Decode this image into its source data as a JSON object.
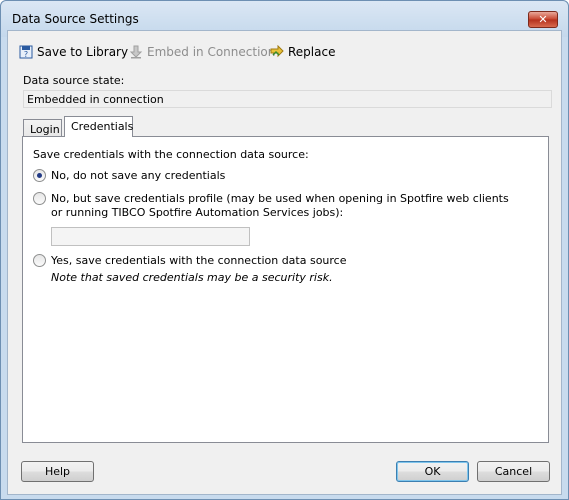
{
  "window": {
    "title": "Data Source Settings",
    "close_glyph": "✕"
  },
  "toolbar": {
    "save_to_library": {
      "label": "Save to Library",
      "icon": "save-library-icon"
    },
    "embed_in_connection": {
      "label": "Embed in Connection",
      "icon": "embed-arrow-icon",
      "disabled": true
    },
    "replace": {
      "label": "Replace",
      "icon": "replace-icon"
    }
  },
  "state": {
    "label": "Data source state:",
    "value": "Embedded in connection"
  },
  "tabs": [
    {
      "label": "Login",
      "active": false
    },
    {
      "label": "Credentials",
      "active": true
    }
  ],
  "credentials": {
    "heading": "Save credentials with the connection data source:",
    "options": [
      {
        "label": "No, do not save any credentials",
        "selected": true
      },
      {
        "label_line1": "No, but save credentials profile (may be used when opening in Spotfire web clients",
        "label_line2": "or running TIBCO Spotfire Automation Services jobs):",
        "selected": false
      },
      {
        "label": "Yes, save credentials with the connection data source",
        "selected": false
      }
    ],
    "profile_value": "",
    "note": "Note that saved credentials may be a security risk."
  },
  "buttons": {
    "help": "Help",
    "ok": "OK",
    "cancel": "Cancel"
  },
  "colors": {
    "titlebar": "#c4d8ec",
    "close": "#c7432c",
    "radio_dot": "#233b86"
  }
}
